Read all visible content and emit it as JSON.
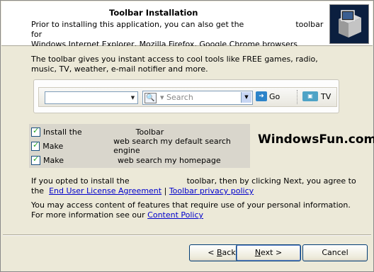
{
  "header": {
    "title": "Toolbar Installation",
    "line1_before": "Prior to installing this application, you can also get the",
    "line1_after": "toolbar for",
    "line2": "Windows Internet Explorer, Mozilla Firefox, Google Chrome browsers"
  },
  "intro": "The toolbar gives you instant access to cool tools like FREE games, radio, music, TV, weather, e-mail notifier and more.",
  "toolbar_preview": {
    "search_placeholder": "Search",
    "go_label": "Go",
    "tv_label": "TV",
    "icons": [
      "search-icon",
      "go-arrow-icon",
      "tv-icon"
    ]
  },
  "options": [
    {
      "before": "Install the",
      "after": "Toolbar",
      "checked": true
    },
    {
      "before": "Make",
      "after": "web search my default search engine",
      "checked": true
    },
    {
      "before": "Make",
      "after": "web search my homepage",
      "checked": true
    }
  ],
  "watermark": "WindowsFun.com",
  "agreement": {
    "text1": "If you opted to install the",
    "text2": "toolbar, then by clicking Next, you agree to",
    "text3": "the",
    "eula_link": "End User License Agreement",
    "separator": "|",
    "privacy_link": "Toolbar privacy policy"
  },
  "more_info": {
    "line1": "You may access content of features that require use of your personal information.",
    "line2": "For more information see our",
    "policy_link": "Content Policy"
  },
  "buttons": {
    "back_mn": "B",
    "back_rest": "ack",
    "back_prefix": "< ",
    "next_mn": "N",
    "next_rest": "ext >",
    "cancel": "Cancel"
  }
}
